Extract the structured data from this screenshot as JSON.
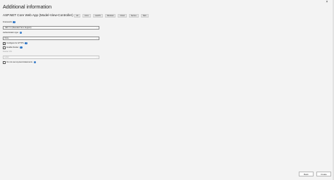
{
  "window": {
    "title": "Additional information",
    "close_glyph": "×"
  },
  "project": {
    "name": "ASP.NET Core Web App (Model-View-Controller)",
    "tags": [
      "C#",
      "Linux",
      "macOS",
      "Windows",
      "Cloud",
      "Service",
      "Web"
    ]
  },
  "form": {
    "framework": {
      "label": "Framework",
      "value": ".NET 7.0 (Standard Term Support)"
    },
    "auth": {
      "label": "Authentication type",
      "value": "None"
    },
    "https": {
      "label": "Configure for HTTPS",
      "checked": true
    },
    "docker": {
      "label": "Enable Docker",
      "checked": false
    },
    "docker_os": {
      "label": "Docker OS",
      "value": "Linux"
    },
    "top_level": {
      "label": "Do not use top-level statements",
      "checked": false
    }
  },
  "footer": {
    "back_label": "Back",
    "create_label": "Create"
  },
  "icons": {
    "info": "i",
    "check": "✓",
    "chevron": "⌄"
  }
}
